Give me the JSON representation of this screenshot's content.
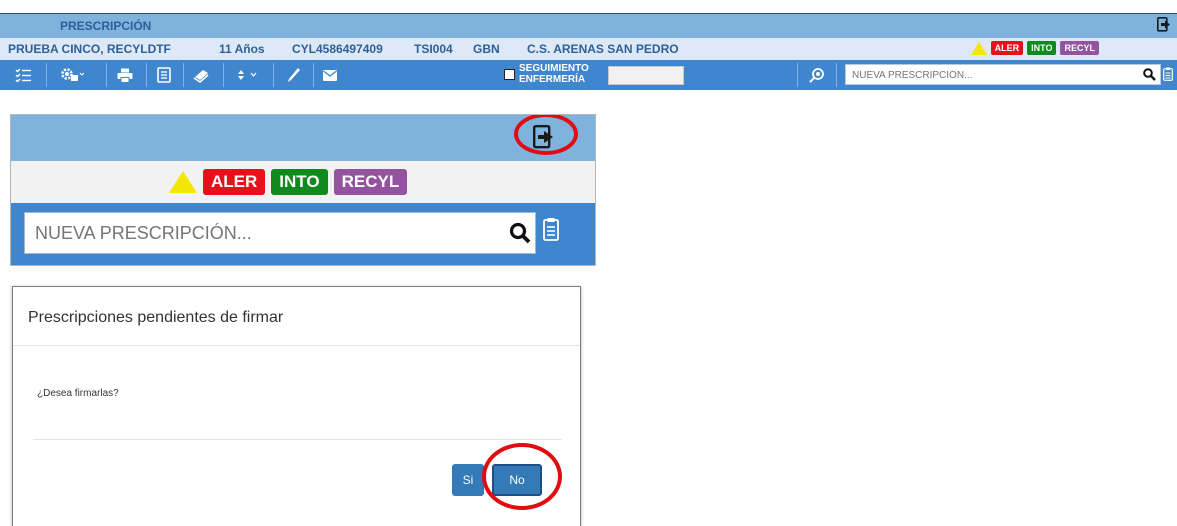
{
  "header": {
    "title": "PRESCRIPCIÓN",
    "patient": {
      "name": "PRUEBA CINCO, RECYLDTF",
      "age": "11 Años",
      "id": "CYL4586497409",
      "tsi": "TSI004",
      "gbn": "GBN",
      "center": "C.S. ARENAS SAN PEDRO"
    },
    "badges": [
      {
        "label": "ALER",
        "color": "#e8101a"
      },
      {
        "label": "INTO",
        "color": "#108a1c"
      },
      {
        "label": "RECYL",
        "color": "#94539f"
      }
    ],
    "toolbar": {
      "seguimiento_line1": "SEGUIMIENTO",
      "seguimiento_line2": "ENFERMERÍA",
      "search_placeholder": "NUEVA PRESCRIPCIÓN..."
    }
  },
  "zoom_panel": {
    "badges": [
      {
        "label": "ALER"
      },
      {
        "label": "INTO"
      },
      {
        "label": "RECYL"
      }
    ],
    "search_placeholder": "NUEVA PRESCRIPCIÓN..."
  },
  "modal": {
    "title": "Prescripciones pendientes de firmar",
    "question": "¿Desea firmarlas?",
    "yes_label": "Si",
    "no_label": "No"
  },
  "colors": {
    "header_light": "#7fb2dd",
    "toolbar": "#3f86cf",
    "highlight": "#e20b10"
  },
  "icons": [
    "exit-icon",
    "checklist-icon",
    "settings-icon",
    "print-icon",
    "notes-icon",
    "book-icon",
    "sort-icon",
    "pen-icon",
    "mail-icon",
    "search-icon",
    "clipboard-icon",
    "alert-triangle-icon"
  ]
}
